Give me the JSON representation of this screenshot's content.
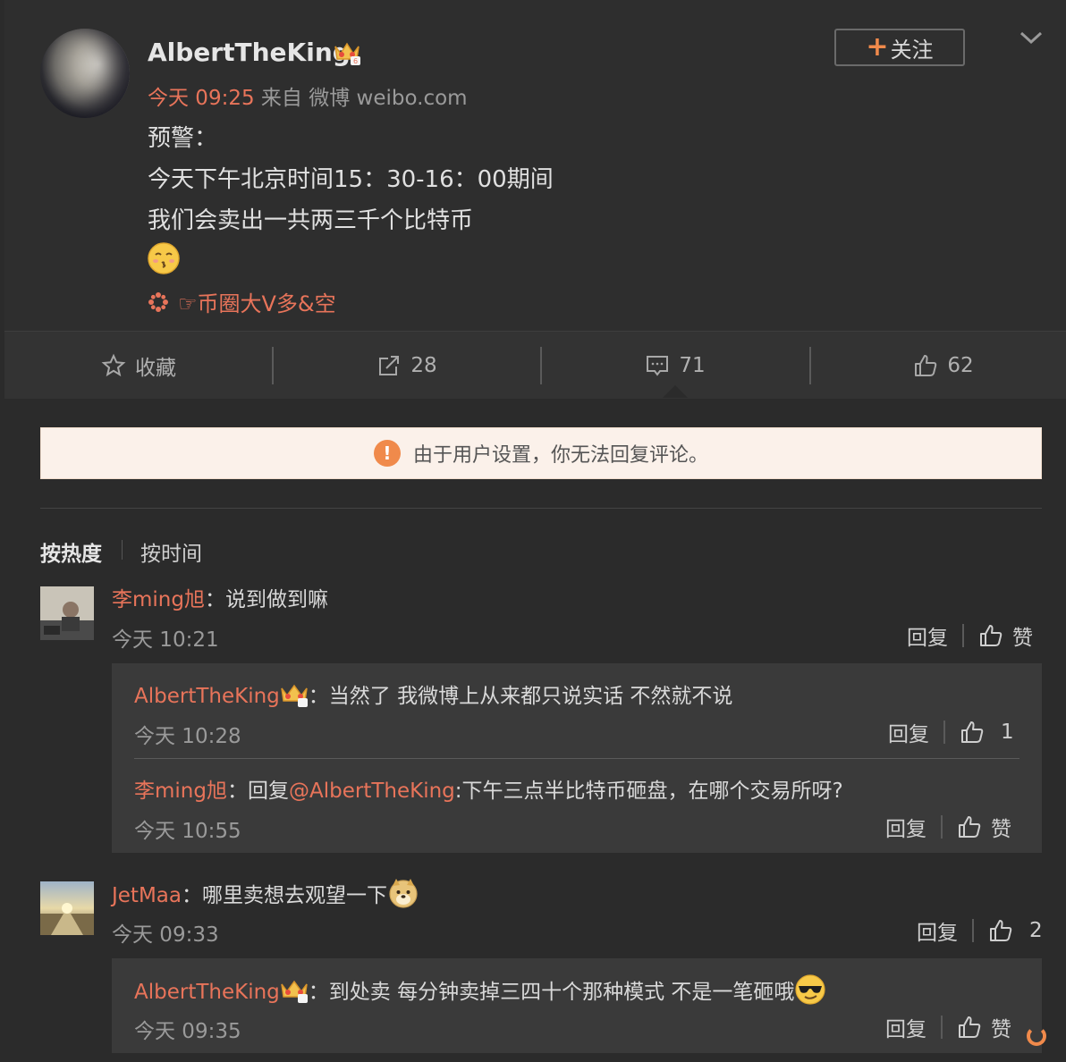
{
  "post": {
    "username": "AlbertTheKing",
    "time": "今天 09:25",
    "source": "来自 微博 weibo.com",
    "follow_label": "关注",
    "lines": [
      "预警：",
      "今天下午北京时间15：30-16：00期间",
      "我们会卖出一共两三千个比特币"
    ],
    "topic": "☞币圈大V多&空"
  },
  "actions": {
    "favorite_label": "收藏",
    "repost_count": "28",
    "comment_count": "71",
    "like_count": "62"
  },
  "notice": {
    "text": "由于用户设置，你无法回复评论。"
  },
  "sort": {
    "hot": "按热度",
    "time": "按时间"
  },
  "comments": [
    {
      "name": "李ming旭",
      "text": "：说到做到嘛",
      "time": "今天 10:21",
      "reply_label": "回复",
      "like_label": "赞",
      "replies": [
        {
          "name": "AlbertTheKing",
          "text": "：当然了 我微博上从来都只说实话 不然就不说",
          "time": "今天 10:28",
          "reply_label": "回复",
          "like_label": "1"
        },
        {
          "name": "李ming旭",
          "text_prefix": "：回复",
          "mention": "@AlbertTheKing",
          "text": ":下午三点半比特币砸盘，在哪个交易所呀?",
          "time": "今天 10:55",
          "reply_label": "回复",
          "like_label": "赞"
        }
      ]
    },
    {
      "name": "JetMaa",
      "text": "：哪里卖想去观望一下",
      "time": "今天 09:33",
      "reply_label": "回复",
      "like_label": "2",
      "replies": [
        {
          "name": "AlbertTheKing",
          "text": "：到处卖 每分钟卖掉三四十个那种模式 不是一笔砸哦",
          "time": "今天 09:35",
          "reply_label": "回复",
          "like_label": "赞"
        }
      ]
    }
  ]
}
